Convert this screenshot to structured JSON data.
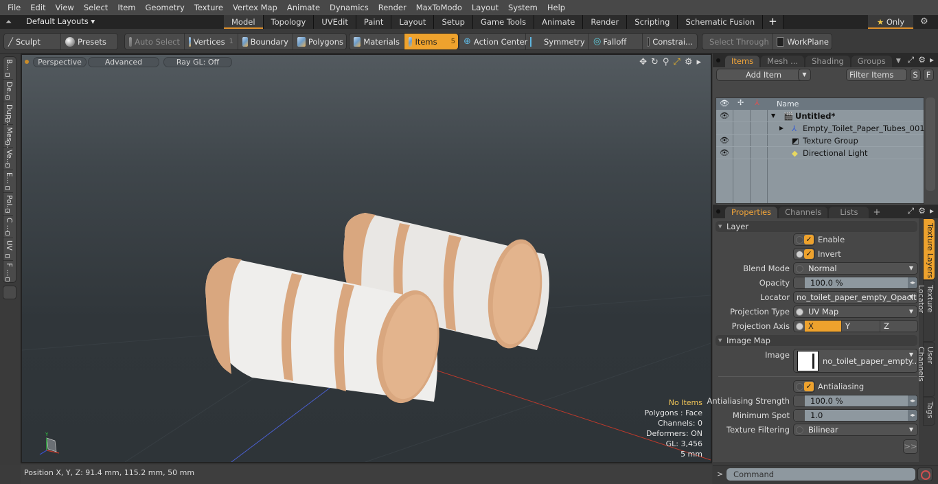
{
  "menu": [
    "File",
    "Edit",
    "View",
    "Select",
    "Item",
    "Geometry",
    "Texture",
    "Vertex Map",
    "Animate",
    "Dynamics",
    "Render",
    "MaxToModo",
    "Layout",
    "System",
    "Help"
  ],
  "layout_bar": {
    "layouts_label": "Default Layouts ▾",
    "tabs": [
      "Model",
      "Topology",
      "UVEdit",
      "Paint",
      "Layout",
      "Setup",
      "Game Tools",
      "Animate",
      "Render",
      "Scripting",
      "Schematic Fusion"
    ],
    "active_tab": "Model",
    "add_tab": "+",
    "only_label": "Only",
    "star": "★"
  },
  "toolbar": {
    "sculpt": "Sculpt",
    "presets": "Presets",
    "auto_select": "Auto Select",
    "vertices": "Vertices",
    "vertices_count": "1",
    "boundary": "Boundary",
    "polygons": "Polygons",
    "materials": "Materials",
    "items": "Items",
    "items_count": "5",
    "action_center": "Action Center",
    "symmetry": "Symmetry",
    "falloff": "Falloff",
    "constraints": "Constrai...",
    "select_through": "Select Through",
    "workplane": "WorkPlane"
  },
  "left_strip": [
    "B...",
    "De...",
    "Dup...",
    "Mes...",
    "Ve...",
    "E...",
    "Pol...",
    "C ...",
    "UV",
    "F ..."
  ],
  "viewport": {
    "perspective": "Perspective",
    "advanced": "Advanced",
    "raygl": "Ray GL: Off",
    "info": {
      "selection": "No Items",
      "polygons": "Polygons : Face",
      "channels": "Channels: 0",
      "deformers": "Deformers: ON",
      "gl": "GL: 3,456",
      "scale": "5 mm"
    },
    "colors": {
      "highlight": "#f1c558",
      "x_axis": "#c0392b",
      "z_axis": "#4a5fd0",
      "cardboard": "#d9a77f"
    }
  },
  "status": {
    "position": "Position X, Y, Z:   91.4 mm, 115.2 mm, 50 mm"
  },
  "items_panel": {
    "tabs": [
      "Items",
      "Mesh ...",
      "Shading",
      "Groups"
    ],
    "active_tab": "Items",
    "add_item": "Add Item",
    "filter": "Filter Items",
    "s_btn": "S",
    "f_btn": "F",
    "name_header": "Name",
    "rows": [
      {
        "label": "Untitled*",
        "visible": true
      },
      {
        "label": "Empty_Toilet_Paper_Tubes_001",
        "visible": false
      },
      {
        "label": "Texture Group",
        "visible": true
      },
      {
        "label": "Directional Light",
        "visible": true
      }
    ]
  },
  "properties_panel": {
    "tabs": [
      "Properties",
      "Channels",
      "Lists"
    ],
    "active_tab": "Properties",
    "add_tab": "+",
    "layer_section": "Layer",
    "enable": "Enable",
    "enable_checked": true,
    "invert": "Invert",
    "invert_checked": true,
    "blend_mode_label": "Blend Mode",
    "blend_mode": "Normal",
    "opacity_label": "Opacity",
    "opacity": "100.0 %",
    "locator_label": "Locator",
    "locator": "no_toilet_paper_empty_Opacit ...",
    "projection_type_label": "Projection Type",
    "projection_type": "UV Map",
    "projection_axis_label": "Projection Axis",
    "projection_axis_options": [
      "X",
      "Y",
      "Z"
    ],
    "projection_axis": "X",
    "image_map_section": "Image Map",
    "image_label": "Image",
    "image": "no_toilet_paper_empty...",
    "antialiasing": "Antialiasing",
    "antialiasing_checked": true,
    "aa_strength_label": "Antialiasing Strength",
    "aa_strength": "100.0 %",
    "min_spot_label": "Minimum Spot",
    "min_spot": "1.0",
    "tex_filter_label": "Texture Filtering",
    "tex_filter": "Bilinear",
    "more": ">>",
    "side_tabs": [
      "Texture Layers",
      "Texture Locator",
      "User Channels",
      "Tags"
    ],
    "active_side_tab": "Texture Layers"
  },
  "command": {
    "prompt": ">",
    "placeholder": "Command"
  }
}
